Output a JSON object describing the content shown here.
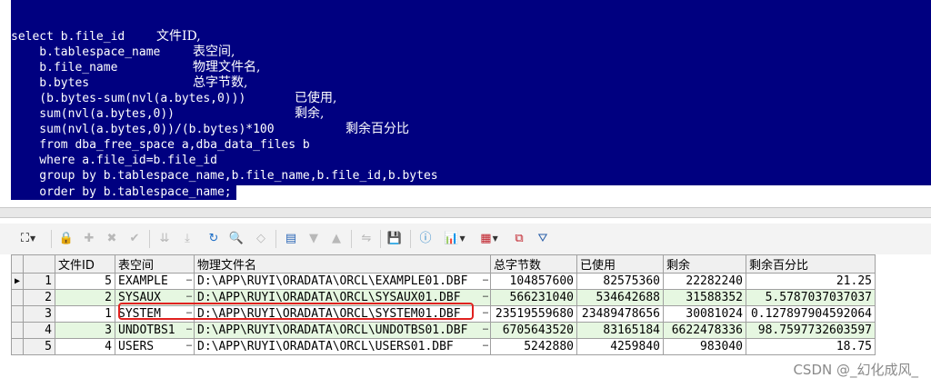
{
  "sql": {
    "lines": [
      {
        "code": "select b.file_id    ",
        "comment": "文件ID,"
      },
      {
        "code": "    b.tablespace_name    ",
        "comment": "表空间,"
      },
      {
        "code": "    b.file_name         ",
        "comment": "物理文件名,"
      },
      {
        "code": "    b.bytes             ",
        "comment": "总字节数,"
      },
      {
        "code": "    (b.bytes-sum(nvl(a.bytes,0)))      ",
        "comment": "已使用,"
      },
      {
        "code": "    sum(nvl(a.bytes,0))                ",
        "comment": "剩余,"
      },
      {
        "code": "    sum(nvl(a.bytes,0))/(b.bytes)*100  ",
        "comment": "剩余百分比"
      },
      {
        "code": "    from dba_free_space a,dba_data_files b",
        "comment": ""
      },
      {
        "code": "    where a.file_id=b.file_id",
        "comment": ""
      },
      {
        "code": "    group by b.tablespace_name,b.file_name,b.file_id,b.bytes",
        "comment": ""
      },
      {
        "code": "    order by b.tablespace_name;",
        "comment": ""
      }
    ]
  },
  "toolbar": {
    "icons": [
      "grid-options-icon",
      "lock-icon",
      "new-record-icon",
      "delete-record-icon",
      "post-check-icon",
      "next-record-icon",
      "last-record-icon",
      "refresh-icon",
      "find-icon",
      "clear-icon",
      "export-icon",
      "filter-down-icon",
      "filter-up-icon",
      "link-icon",
      "save-icon",
      "chart-info-icon",
      "bar-chart-icon",
      "table-view-icon",
      "compare-icon",
      "filter-icon"
    ]
  },
  "grid": {
    "headers": [
      "文件ID",
      "表空间",
      "物理文件名",
      "总字节数",
      "已使用",
      "剩余",
      "剩余百分比"
    ],
    "rows": [
      {
        "rownum": "1",
        "file_id": "5",
        "tablespace": "EXAMPLE",
        "file_name": "D:\\APP\\RUYI\\ORADATA\\ORCL\\EXAMPLE01.DBF",
        "total": "104857600",
        "used": "82575360",
        "remaining": "22282240",
        "pct": "21.25"
      },
      {
        "rownum": "2",
        "file_id": "2",
        "tablespace": "SYSAUX",
        "file_name": "D:\\APP\\RUYI\\ORADATA\\ORCL\\SYSAUX01.DBF",
        "total": "566231040",
        "used": "534642688",
        "remaining": "31588352",
        "pct": "5.5787037037037"
      },
      {
        "rownum": "3",
        "file_id": "1",
        "tablespace": "SYSTEM",
        "file_name": "D:\\APP\\RUYI\\ORADATA\\ORCL\\SYSTEM01.DBF",
        "total": "23519559680",
        "used": "23489478656",
        "remaining": "30081024",
        "pct": "0.127897904592064"
      },
      {
        "rownum": "4",
        "file_id": "3",
        "tablespace": "UNDOTBS1",
        "file_name": "D:\\APP\\RUYI\\ORADATA\\ORCL\\UNDOTBS01.DBF",
        "total": "6705643520",
        "used": "83165184",
        "remaining": "6622478336",
        "pct": "98.7597732603597"
      },
      {
        "rownum": "5",
        "file_id": "4",
        "tablespace": "USERS",
        "file_name": "D:\\APP\\RUYI\\ORADATA\\ORCL\\USERS01.DBF",
        "total": "5242880",
        "used": "4259840",
        "remaining": "983040",
        "pct": "18.75"
      }
    ],
    "ellipsis": "…",
    "current_row_marker": "▶"
  },
  "watermark": "CSDN @_幻化成风_",
  "colors": {
    "selection": "#000080",
    "alt_row": "#e6f7e1",
    "highlight_box": "#e0211f"
  }
}
